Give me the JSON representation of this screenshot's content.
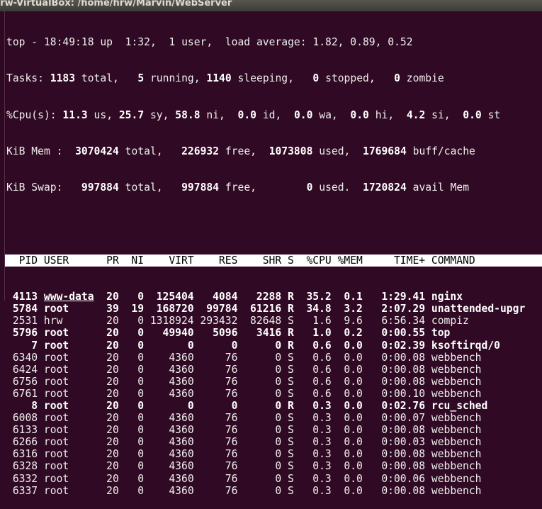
{
  "window": {
    "title": "hrw-VirtualBox: /home/hrw/Marvin/WebServer"
  },
  "summary": {
    "uptime": {
      "prefix": "top - 18:49:18 up  1:32,  1 user,  load average: 1.82, 0.89, 0.52"
    },
    "tasks": {
      "label": "Tasks: ",
      "total": "1183",
      "total_l": " total,   ",
      "running": "5",
      "running_l": " running, ",
      "sleeping": "1140",
      "sleeping_l": " sleeping,   ",
      "stopped": "0",
      "stopped_l": " stopped,   ",
      "zombie": "0",
      "zombie_l": " zombie"
    },
    "cpu": {
      "label": "%Cpu(s): ",
      "us": "11.3",
      "us_l": " us, ",
      "sy": "25.7",
      "sy_l": " sy, ",
      "ni": "58.8",
      "ni_l": " ni,  ",
      "id": "0.0",
      "id_l": " id,  ",
      "wa": "0.0",
      "wa_l": " wa,  ",
      "hi": "0.0",
      "hi_l": " hi,  ",
      "si": "4.2",
      "si_l": " si,  ",
      "st": "0.0",
      "st_l": " st"
    },
    "mem": {
      "label": "KiB Mem :  ",
      "total": "3070424",
      "total_l": " total,   ",
      "free": "226932",
      "free_l": " free,  ",
      "used": "1073808",
      "used_l": " used,  ",
      "cache": "1769684",
      "cache_l": " buff/cache"
    },
    "swap": {
      "label": "KiB Swap:   ",
      "total": "997884",
      "total_l": " total,   ",
      "free": "997884",
      "free_l": " free,        ",
      "used": "0",
      "used_l": " used.  ",
      "avail": "1720824",
      "avail_l": " avail Mem"
    }
  },
  "table": {
    "headers": {
      "pid": "PID",
      "user": "USER",
      "pr": "PR",
      "ni": "NI",
      "virt": "VIRT",
      "res": "RES",
      "shr": "SHR",
      "s": "S",
      "cpu": "%CPU",
      "mem": "%MEM",
      "time": "TIME+",
      "command": "COMMAND"
    },
    "rows": [
      {
        "pid": "4113",
        "user": "www-data",
        "pr": "20",
        "ni": "0",
        "virt": "125404",
        "res": "4084",
        "shr": "2288",
        "s": "R",
        "cpu": "35.2",
        "mem": "0.1",
        "time": "1:29.41",
        "command": "nginx"
      },
      {
        "pid": "5784",
        "user": "root",
        "pr": "39",
        "ni": "19",
        "virt": "168720",
        "res": "99784",
        "shr": "61216",
        "s": "R",
        "cpu": "34.8",
        "mem": "3.2",
        "time": "2:07.29",
        "command": "unattended-upgr"
      },
      {
        "pid": "2531",
        "user": "hrw",
        "pr": "20",
        "ni": "0",
        "virt": "1318924",
        "res": "293432",
        "shr": "82648",
        "s": "S",
        "cpu": "1.6",
        "mem": "9.6",
        "time": "6:56.34",
        "command": "compiz"
      },
      {
        "pid": "5796",
        "user": "root",
        "pr": "20",
        "ni": "0",
        "virt": "49940",
        "res": "5096",
        "shr": "3416",
        "s": "R",
        "cpu": "1.0",
        "mem": "0.2",
        "time": "0:00.55",
        "command": "top"
      },
      {
        "pid": "7",
        "user": "root",
        "pr": "20",
        "ni": "0",
        "virt": "0",
        "res": "0",
        "shr": "0",
        "s": "R",
        "cpu": "0.6",
        "mem": "0.0",
        "time": "0:02.39",
        "command": "ksoftirqd/0"
      },
      {
        "pid": "6340",
        "user": "root",
        "pr": "20",
        "ni": "0",
        "virt": "4360",
        "res": "76",
        "shr": "0",
        "s": "S",
        "cpu": "0.6",
        "mem": "0.0",
        "time": "0:00.08",
        "command": "webbench"
      },
      {
        "pid": "6424",
        "user": "root",
        "pr": "20",
        "ni": "0",
        "virt": "4360",
        "res": "76",
        "shr": "0",
        "s": "S",
        "cpu": "0.6",
        "mem": "0.0",
        "time": "0:00.08",
        "command": "webbench"
      },
      {
        "pid": "6756",
        "user": "root",
        "pr": "20",
        "ni": "0",
        "virt": "4360",
        "res": "76",
        "shr": "0",
        "s": "S",
        "cpu": "0.6",
        "mem": "0.0",
        "time": "0:00.08",
        "command": "webbench"
      },
      {
        "pid": "6761",
        "user": "root",
        "pr": "20",
        "ni": "0",
        "virt": "4360",
        "res": "76",
        "shr": "0",
        "s": "S",
        "cpu": "0.6",
        "mem": "0.0",
        "time": "0:00.10",
        "command": "webbench"
      },
      {
        "pid": "8",
        "user": "root",
        "pr": "20",
        "ni": "0",
        "virt": "0",
        "res": "0",
        "shr": "0",
        "s": "R",
        "cpu": "0.3",
        "mem": "0.0",
        "time": "0:02.76",
        "command": "rcu_sched"
      },
      {
        "pid": "6008",
        "user": "root",
        "pr": "20",
        "ni": "0",
        "virt": "4360",
        "res": "76",
        "shr": "0",
        "s": "S",
        "cpu": "0.3",
        "mem": "0.0",
        "time": "0:00.07",
        "command": "webbench"
      },
      {
        "pid": "6133",
        "user": "root",
        "pr": "20",
        "ni": "0",
        "virt": "4360",
        "res": "76",
        "shr": "0",
        "s": "S",
        "cpu": "0.3",
        "mem": "0.0",
        "time": "0:00.08",
        "command": "webbench"
      },
      {
        "pid": "6266",
        "user": "root",
        "pr": "20",
        "ni": "0",
        "virt": "4360",
        "res": "76",
        "shr": "0",
        "s": "S",
        "cpu": "0.3",
        "mem": "0.0",
        "time": "0:00.03",
        "command": "webbench"
      },
      {
        "pid": "6316",
        "user": "root",
        "pr": "20",
        "ni": "0",
        "virt": "4360",
        "res": "76",
        "shr": "0",
        "s": "S",
        "cpu": "0.3",
        "mem": "0.0",
        "time": "0:00.08",
        "command": "webbench"
      },
      {
        "pid": "6328",
        "user": "root",
        "pr": "20",
        "ni": "0",
        "virt": "4360",
        "res": "76",
        "shr": "0",
        "s": "S",
        "cpu": "0.3",
        "mem": "0.0",
        "time": "0:00.08",
        "command": "webbench"
      },
      {
        "pid": "6332",
        "user": "root",
        "pr": "20",
        "ni": "0",
        "virt": "4360",
        "res": "76",
        "shr": "0",
        "s": "S",
        "cpu": "0.3",
        "mem": "0.0",
        "time": "0:00.06",
        "command": "webbench"
      },
      {
        "pid": "6337",
        "user": "root",
        "pr": "20",
        "ni": "0",
        "virt": "4360",
        "res": "76",
        "shr": "0",
        "s": "S",
        "cpu": "0.3",
        "mem": "0.0",
        "time": "0:00.08",
        "command": "webbench"
      }
    ]
  },
  "colors": {
    "background": "#300a24",
    "header_bg": "#ffffff",
    "text": "#eeeeec"
  }
}
